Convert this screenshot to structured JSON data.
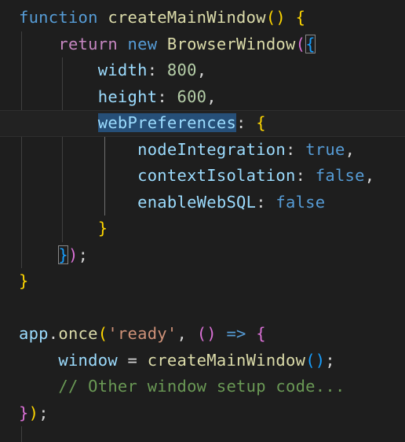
{
  "editor": {
    "lines": [
      {
        "tokens": [
          {
            "t": "function",
            "c": "k-kw"
          },
          {
            "t": " ",
            "c": "k-punc"
          },
          {
            "t": "createMainWindow",
            "c": "k-fn"
          },
          {
            "t": "()",
            "c": "b1"
          },
          {
            "t": " ",
            "c": "k-punc"
          },
          {
            "t": "{",
            "c": "b1"
          }
        ]
      },
      {
        "tokens": [
          {
            "t": "    ",
            "c": "k-punc"
          },
          {
            "t": "return",
            "c": "k-ctl"
          },
          {
            "t": " ",
            "c": "k-punc"
          },
          {
            "t": "new",
            "c": "k-kw"
          },
          {
            "t": " ",
            "c": "k-punc"
          },
          {
            "t": "BrowserWindow",
            "c": "k-fn"
          },
          {
            "t": "(",
            "c": "b2"
          },
          {
            "t": "{",
            "c": "b3 bm"
          }
        ]
      },
      {
        "tokens": [
          {
            "t": "        ",
            "c": "k-punc"
          },
          {
            "t": "width",
            "c": "k-prop"
          },
          {
            "t": ": ",
            "c": "k-punc"
          },
          {
            "t": "800",
            "c": "k-num"
          },
          {
            "t": ",",
            "c": "k-punc"
          }
        ]
      },
      {
        "tokens": [
          {
            "t": "        ",
            "c": "k-punc"
          },
          {
            "t": "height",
            "c": "k-prop"
          },
          {
            "t": ": ",
            "c": "k-punc"
          },
          {
            "t": "600",
            "c": "k-num"
          },
          {
            "t": ",",
            "c": "k-punc"
          }
        ]
      },
      {
        "current": true,
        "tokens": [
          {
            "t": "        ",
            "c": "k-punc"
          },
          {
            "t": "webPreferences",
            "c": "k-prop sel"
          },
          {
            "t": ": ",
            "c": "k-punc"
          },
          {
            "t": "{",
            "c": "b1"
          }
        ]
      },
      {
        "tokens": [
          {
            "t": "            ",
            "c": "k-punc"
          },
          {
            "t": "nodeIntegration",
            "c": "k-prop"
          },
          {
            "t": ": ",
            "c": "k-punc"
          },
          {
            "t": "true",
            "c": "k-kw"
          },
          {
            "t": ",",
            "c": "k-punc"
          }
        ]
      },
      {
        "tokens": [
          {
            "t": "            ",
            "c": "k-punc"
          },
          {
            "t": "contextIsolation",
            "c": "k-prop"
          },
          {
            "t": ": ",
            "c": "k-punc"
          },
          {
            "t": "false",
            "c": "k-kw"
          },
          {
            "t": ",",
            "c": "k-punc"
          }
        ]
      },
      {
        "tokens": [
          {
            "t": "            ",
            "c": "k-punc"
          },
          {
            "t": "enableWebSQL",
            "c": "k-prop"
          },
          {
            "t": ": ",
            "c": "k-punc"
          },
          {
            "t": "false",
            "c": "k-kw"
          }
        ]
      },
      {
        "tokens": [
          {
            "t": "        ",
            "c": "k-punc"
          },
          {
            "t": "}",
            "c": "b1"
          }
        ]
      },
      {
        "tokens": [
          {
            "t": "    ",
            "c": "k-punc"
          },
          {
            "t": "}",
            "c": "b3 bm"
          },
          {
            "t": ")",
            "c": "b2"
          },
          {
            "t": ";",
            "c": "k-punc"
          }
        ]
      },
      {
        "tokens": [
          {
            "t": "}",
            "c": "b1"
          }
        ]
      },
      {
        "tokens": []
      },
      {
        "tokens": [
          {
            "t": "app",
            "c": "k-prop"
          },
          {
            "t": ".",
            "c": "k-punc"
          },
          {
            "t": "once",
            "c": "k-fn"
          },
          {
            "t": "(",
            "c": "b1"
          },
          {
            "t": "'ready'",
            "c": "k-str"
          },
          {
            "t": ", ",
            "c": "k-punc"
          },
          {
            "t": "()",
            "c": "b2"
          },
          {
            "t": " ",
            "c": "k-punc"
          },
          {
            "t": "=>",
            "c": "k-kw"
          },
          {
            "t": " ",
            "c": "k-punc"
          },
          {
            "t": "{",
            "c": "b2"
          }
        ]
      },
      {
        "tokens": [
          {
            "t": "    ",
            "c": "k-punc"
          },
          {
            "t": "window",
            "c": "k-prop"
          },
          {
            "t": " = ",
            "c": "k-punc"
          },
          {
            "t": "createMainWindow",
            "c": "k-fn"
          },
          {
            "t": "()",
            "c": "b3"
          },
          {
            "t": ";",
            "c": "k-punc"
          }
        ]
      },
      {
        "tokens": [
          {
            "t": "    ",
            "c": "k-punc"
          },
          {
            "t": "// Other window setup code...",
            "c": "k-com"
          }
        ]
      },
      {
        "tokens": [
          {
            "t": "}",
            "c": "b2"
          },
          {
            "t": ")",
            "c": "b1"
          },
          {
            "t": ";",
            "c": "k-punc"
          }
        ]
      },
      {
        "tokens": []
      }
    ]
  }
}
